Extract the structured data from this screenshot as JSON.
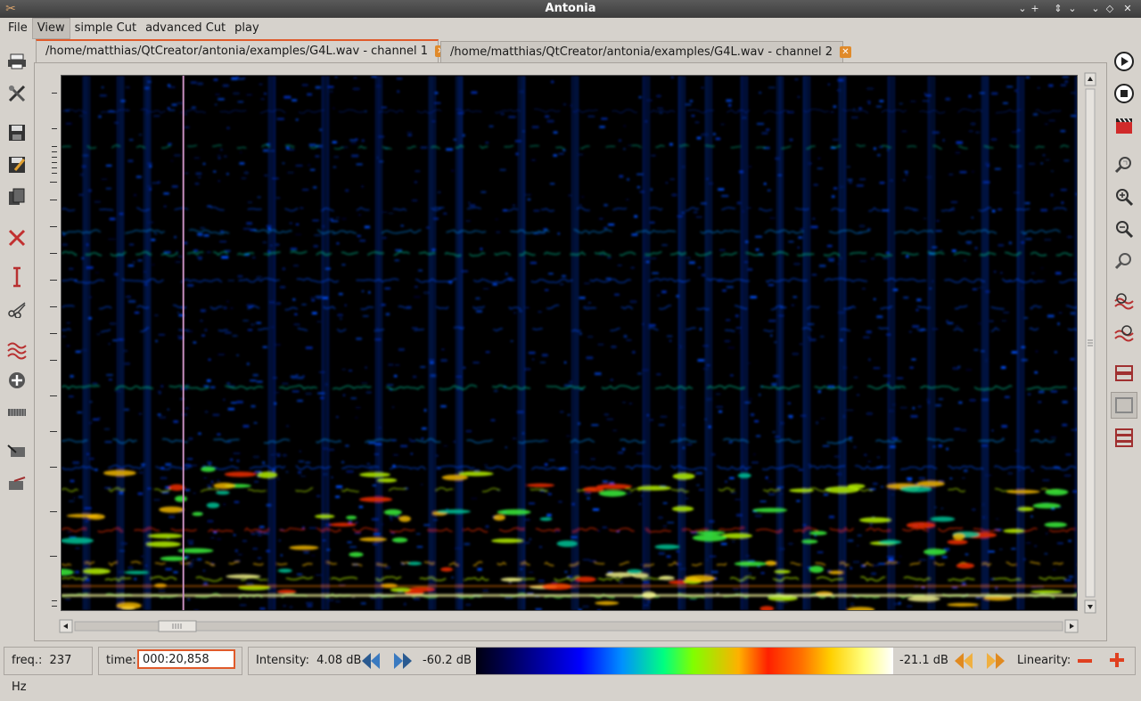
{
  "window": {
    "title": "Antonia"
  },
  "menu": [
    "File",
    "View",
    "simple Cut",
    "advanced Cut",
    "play"
  ],
  "tabs": [
    {
      "label": "/home/matthias/QtCreator/antonia/examples/G4L.wav - channel 1",
      "active": true
    },
    {
      "label": "/home/matthias/QtCreator/antonia/examples/G4L.wav - channel 2",
      "active": false
    }
  ],
  "left_toolbar": [
    "print-icon",
    "tools-icon",
    "save-icon",
    "save-as-icon",
    "copy-icon",
    "delete-icon",
    "cursor-icon",
    "scissors-icon",
    "filter-icon",
    "add-icon",
    "ruler-icon",
    "import-icon",
    "export-icon"
  ],
  "right_toolbar": [
    "play-icon",
    "stop-icon",
    "clapper-icon",
    "zoom-fit-icon",
    "zoom-in-icon",
    "zoom-out-icon",
    "zoom-reset-icon",
    "wave-add-icon",
    "wave-remove-icon",
    "split-view-icon",
    "single-view-icon",
    "stack-view-icon"
  ],
  "status": {
    "freq_label": "freq.:",
    "freq_value": "237 Hz",
    "time_label": "time:",
    "time_value": "000:20,858",
    "intensity_label": "Intensity:",
    "intensity_value": "4.08 dB",
    "db_min": "-60.2 dB",
    "db_max": "-21.1 dB",
    "linearity_label": "Linearity:"
  },
  "playhead_fraction": 0.12,
  "colors": {
    "accent": "#e05a2a",
    "playhead": "#c890c0",
    "spectrogram_bg": "#000000"
  }
}
